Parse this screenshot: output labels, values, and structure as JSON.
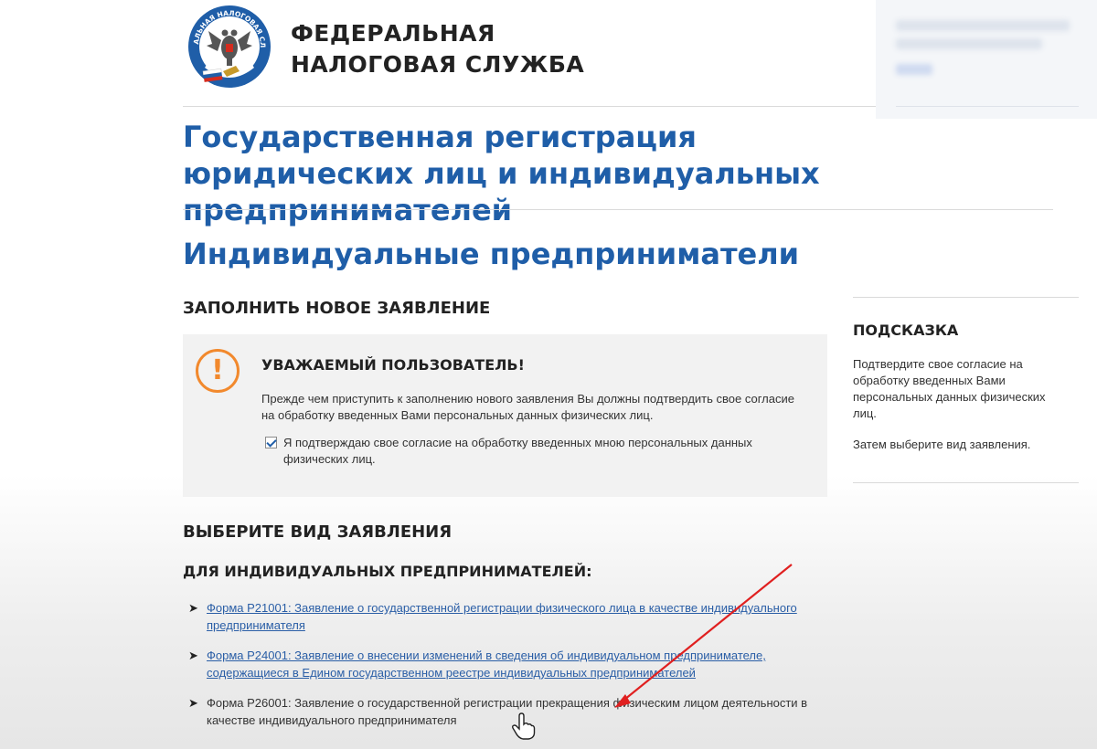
{
  "header": {
    "org_line1": "ФЕДЕРАЛЬНАЯ",
    "org_line2": "НАЛОГОВАЯ СЛУЖБА",
    "logo_text": "ФЕДЕРАЛЬНАЯ НАЛОГОВАЯ СЛУЖБА"
  },
  "page": {
    "title": "Государственная регистрация юридических лиц и индивидуальных предпринимателей",
    "section_title": "Индивидуальные предприниматели",
    "new_application_heading": "ЗАПОЛНИТЬ НОВОЕ ЗАЯВЛЕНИЕ"
  },
  "notice": {
    "icon": "exclamation-circle-icon",
    "title": "УВАЖАЕМЫЙ ПОЛЬЗОВАТЕЛЬ!",
    "text": "Прежде чем приступить к заполнению нового заявления Вы должны подтвердить свое согласие на обработку введенных Вами персональных данных физических лиц.",
    "consent_label": "Я подтверждаю свое согласие на обработку введенных мною персональных данных физических лиц.",
    "consent_checked": true
  },
  "hint": {
    "title": "ПОДСКАЗКА",
    "text": "Подтвердите свое согласие на обработку введенных Вами персональных данных физических лиц.",
    "text2": "Затем выберите вид заявления."
  },
  "application": {
    "choose_heading": "ВЫБЕРИТЕ ВИД ЗАЯВЛЕНИЯ",
    "group_heading": "ДЛЯ ИНДИВИДУАЛЬНЫХ ПРЕДПРИНИМАТЕЛЕЙ:",
    "forms": [
      {
        "label": "Форма Р21001: Заявление о государственной регистрации физического лица в качестве индивидуального предпринимателя"
      },
      {
        "label": "Форма Р24001: Заявление о внесении изменений в сведения об индивидуальном предпринимателе, содержащиеся в Едином государственном реестре индивидуальных предпринимателей"
      },
      {
        "label": "Форма Р26001: Заявление о государственной регистрации прекращения физическим лицом деятельности в качестве индивидуального предпринимателя"
      }
    ]
  },
  "colors": {
    "title_blue": "#1f5ea8",
    "warning_orange": "#f2892d",
    "annotation_red": "#e02020"
  }
}
